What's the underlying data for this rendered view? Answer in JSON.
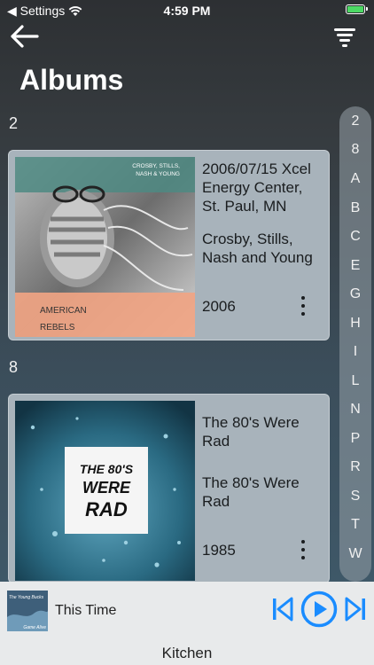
{
  "status": {
    "back_app": "◀ Settings",
    "time": "4:59 PM"
  },
  "page": {
    "title": "Albums"
  },
  "sections": [
    {
      "header": "2",
      "album": {
        "name": "2006/07/15 Xcel Energy Center, St. Paul, MN",
        "artist": "Crosby, Stills, Nash and Young",
        "year": "2006",
        "art_top_text": "CROSBY, STILLS, NASH & YOUNG",
        "art_bottom_line1": "AMERICAN",
        "art_bottom_line2": "REBELS"
      }
    },
    {
      "header": "8",
      "album": {
        "name": "The 80's Were Rad",
        "artist": "The 80's Were Rad",
        "year": "1985",
        "art_line1": "THE 80'S",
        "art_line2": "WERE",
        "art_line3": "RAD"
      }
    }
  ],
  "index_letters": [
    "2",
    "8",
    "A",
    "B",
    "C",
    "E",
    "G",
    "H",
    "I",
    "L",
    "N",
    "P",
    "R",
    "S",
    "T",
    "W"
  ],
  "player": {
    "track": "This Time",
    "zone": "Kitchen",
    "thumb_text1": "The Young Bucks",
    "thumb_text2": "Game Alive"
  },
  "colors": {
    "accent": "#1a8cff",
    "battery": "#4cd964",
    "card": "#a8b3bb",
    "art1_bottom": "#f0a483",
    "art1_top": "#4d8a82",
    "art2_background": "#2a6a82"
  },
  "icons": {
    "back": "arrow-left-icon",
    "filter": "filter-icon",
    "more": "more-vertical-icon",
    "prev": "skip-previous-icon",
    "play": "play-circle-icon",
    "next": "skip-next-icon",
    "wifi": "wifi-icon",
    "battery": "battery-charging-icon"
  }
}
